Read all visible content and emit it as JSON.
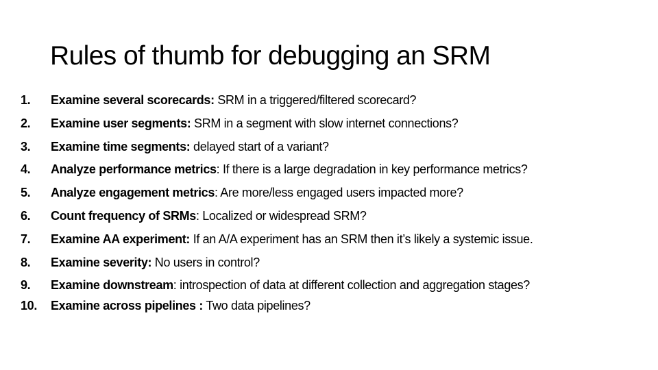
{
  "slide": {
    "title": "Rules of thumb for debugging an SRM",
    "rules": [
      {
        "number": "1.",
        "name": "Examine several scorecards:",
        "text": " SRM in a triggered/filtered scorecard?"
      },
      {
        "number": "2.",
        "name": "Examine user segments:",
        "text": " SRM in a segment with slow internet connections?"
      },
      {
        "number": "3.",
        "name": "Examine time segments:",
        "text": " delayed start of a variant?"
      },
      {
        "number": "4.",
        "name": "Analyze performance metrics",
        "text": ": If there is a large degradation in key performance metrics?"
      },
      {
        "number": "5.",
        "name": "Analyze engagement metrics",
        "text": ": Are more/less engaged users impacted more?"
      },
      {
        "number": "6.",
        "name": "Count frequency of SRMs",
        "text": ": Localized or widespread SRM?"
      },
      {
        "number": "7.",
        "name": "Examine AA experiment:",
        "text": " If an A/A experiment has an SRM then it’s likely a systemic issue."
      },
      {
        "number": "8.",
        "name": "Examine severity:",
        "text": " No users in control?"
      },
      {
        "number": "9.",
        "name": "Examine downstream",
        "text": ": introspection of data at different collection and aggregation stages?"
      },
      {
        "number": "10.",
        "name": "Examine across pipelines :",
        "text": " Two data pipelines?"
      }
    ]
  }
}
